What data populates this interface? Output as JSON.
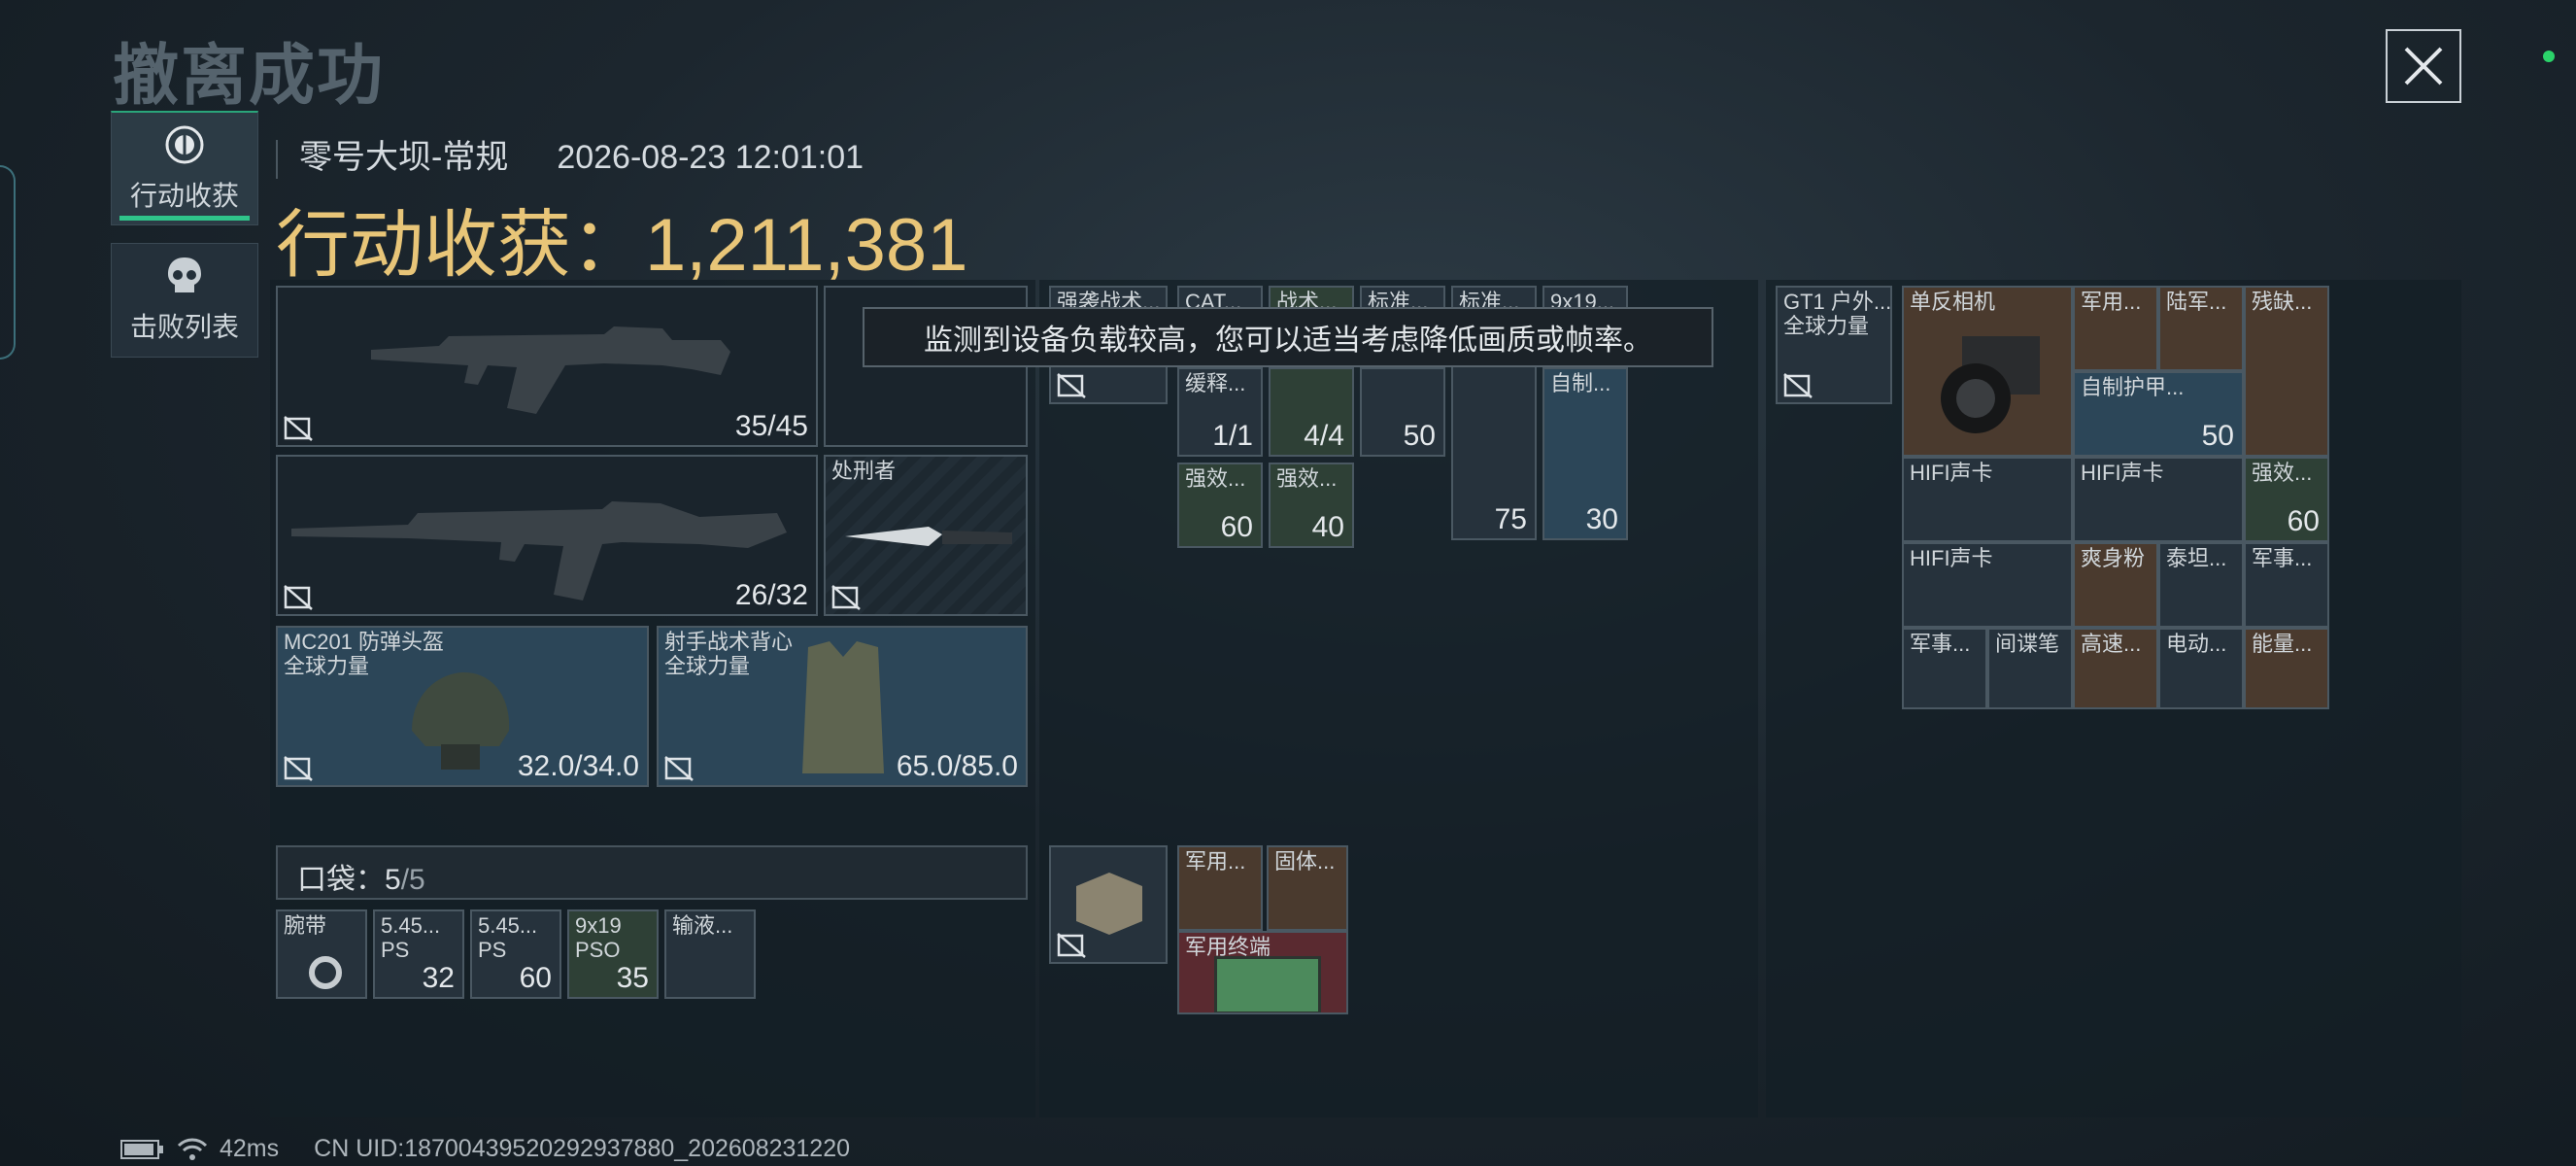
{
  "header": {
    "title": "撤离成功",
    "map_mode": "零号大坝-常规",
    "timestamp": "2026-08-23 12:01:01",
    "total_label": "行动收获：",
    "total_value": "1,211,381"
  },
  "tabs": [
    {
      "label": "行动收获",
      "active": true
    },
    {
      "label": "击败列表",
      "active": false
    }
  ],
  "toast": "监测到设备负载较高，您可以适当考虑降低画质或帧率。",
  "loadout": {
    "weapon1_ammo": "35/45",
    "weapon2_ammo": "26/32",
    "melee_label": "处刑者",
    "helmet_label": "MC201 防弹头盔",
    "helmet_brand": "全球力量",
    "helmet_durability": "32.0/34.0",
    "vest_label": "射手战术背心",
    "vest_brand": "全球力量",
    "vest_durability": "65.0/85.0"
  },
  "pockets": {
    "label": "口袋：",
    "used": "5",
    "total": "/5",
    "items": [
      {
        "label": "腕带",
        "count": ""
      },
      {
        "label": "5.45... PS",
        "count": "32"
      },
      {
        "label": "5.45... PS",
        "count": "60"
      },
      {
        "label": "9x19 PSO",
        "count": "35"
      },
      {
        "label": "输液...",
        "count": ""
      }
    ]
  },
  "rig": {
    "items": [
      {
        "label": "强袭战术...",
        "count": ""
      },
      {
        "label": "CAT...",
        "count": ""
      },
      {
        "label": "战术...",
        "count": ""
      },
      {
        "label": "标准...",
        "count": ""
      },
      {
        "label": "标准...",
        "count": ""
      },
      {
        "label": "9x19...",
        "count": ""
      },
      {
        "label": "缓释...",
        "count": "1/1"
      },
      {
        "label": "",
        "count": "4/4"
      },
      {
        "label": "",
        "count": "50"
      },
      {
        "label": "自制...",
        "count": ""
      },
      {
        "label": "强效...",
        "count": "60"
      },
      {
        "label": "强效...",
        "count": "40"
      },
      {
        "label": "",
        "count": "75"
      },
      {
        "label": "",
        "count": "30"
      }
    ]
  },
  "backpack_bottom": {
    "items": [
      {
        "label": "军用...",
        "count": ""
      },
      {
        "label": "固体...",
        "count": ""
      },
      {
        "label": "军用终端",
        "count": ""
      }
    ]
  },
  "backpack": {
    "bag_label": "GT1 户外...",
    "bag_brand": "全球力量",
    "items": [
      {
        "label": "单反相机",
        "count": ""
      },
      {
        "label": "军用...",
        "count": ""
      },
      {
        "label": "陆军...",
        "count": ""
      },
      {
        "label": "残缺...",
        "count": ""
      },
      {
        "label": "自制护甲...",
        "count": "50"
      },
      {
        "label": "HIFI声卡",
        "count": ""
      },
      {
        "label": "HIFI声卡",
        "count": ""
      },
      {
        "label": "强效...",
        "count": "60"
      },
      {
        "label": "HIFI声卡",
        "count": ""
      },
      {
        "label": "爽身粉",
        "count": ""
      },
      {
        "label": "泰坦...",
        "count": ""
      },
      {
        "label": "军事...",
        "count": ""
      },
      {
        "label": "军事...",
        "count": ""
      },
      {
        "label": "间谍笔",
        "count": ""
      },
      {
        "label": "高速...",
        "count": ""
      },
      {
        "label": "电动...",
        "count": ""
      },
      {
        "label": "能量...",
        "count": ""
      }
    ]
  },
  "footer": {
    "ping": "42ms",
    "uid": "CN UID:18700439520292937880_202608231220"
  },
  "colors": {
    "accent_gold": "#e8c578",
    "active_tab": "#2fc48a",
    "status_dot": "#2bd36a"
  },
  "icons": [
    "close-icon",
    "action-harvest-icon",
    "skull-icon",
    "no-insure-icon",
    "battery-icon",
    "wifi-icon"
  ]
}
